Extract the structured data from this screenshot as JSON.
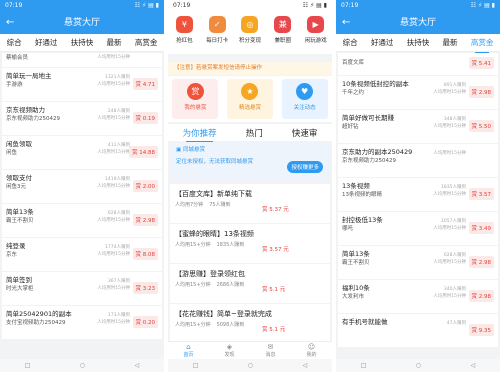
{
  "status": {
    "time": "07:19",
    "right": "☷ ⚡ ▤ ▮"
  },
  "p1": {
    "title": "悬赏大厅",
    "back": "←",
    "tabs": [
      "综合",
      "好通过",
      "扶持快",
      "最新",
      "高赏金"
    ],
    "items": [
      {
        "t": "",
        "sub": "蔡榆会员",
        "s1": "",
        "s2": "人均用时15分钟",
        "r": ""
      },
      {
        "t": "简单玩一局地主",
        "sub": "手游游",
        "s1": "1321人赚到",
        "s2": "人均用时15分钟",
        "r": "赏 4.71"
      },
      {
        "t": "京东视频助力",
        "sub": "京东视频助力250429",
        "s1": "248人赚到",
        "s2": "人均用时15分钟",
        "r": "赏 0.19"
      },
      {
        "t": "闲鱼领取",
        "sub": "闲鱼",
        "s1": "411人赚到",
        "s2": "人均用时15分钟",
        "r": "赏 14.88"
      },
      {
        "t": "领取支付",
        "sub": "闲鱼3元",
        "s1": "1419人赚到",
        "s2": "人均用时15分钟",
        "r": "赏 2.00"
      },
      {
        "t": "简单13条",
        "sub": "霸王不割贝",
        "s1": "628人赚到",
        "s2": "人均用时15分钟",
        "r": "赏 2.98"
      },
      {
        "t": "纯登录",
        "sub": "京东",
        "s1": "1774人赚到",
        "s2": "人均用时15分钟",
        "r": "赏 8.08"
      },
      {
        "t": "简单签到",
        "sub": "时光大掌柜",
        "s1": "367人赚到",
        "s2": "人均用时15分钟",
        "r": "赏 3.23"
      },
      {
        "t": "简单25042901的副本",
        "sub": "支付宝视频助力250429",
        "s1": "173人赚到",
        "s2": "人均用时15分钟",
        "r": "赏 0.20"
      }
    ],
    "nav": [
      "□",
      "○",
      "◁"
    ]
  },
  "p2": {
    "icons": [
      {
        "l": "抢红包",
        "g": "¥",
        "c": "#f0533c"
      },
      {
        "l": "每日打卡",
        "g": "✓",
        "c": "#f08a3c"
      },
      {
        "l": "积分变现",
        "g": "◎",
        "c": "#f5a623"
      },
      {
        "l": "兼职圈",
        "g": "兼",
        "c": "#e8484c"
      },
      {
        "l": "闲玩游戏",
        "g": "▶",
        "c": "#e8484c"
      }
    ],
    "notice": "【注意】若悬赏案发短信请停止操作",
    "cards": [
      {
        "l": "我的悬赏",
        "g": "赏",
        "bg": "#fdeeed",
        "c": "#f0533c"
      },
      {
        "l": "精选悬赏",
        "g": "★",
        "bg": "#fff4e0",
        "c": "#f5a623"
      },
      {
        "l": "关注动态",
        "g": "♥",
        "bg": "#e8f3ff",
        "c": "#2f9bf0"
      }
    ],
    "tabs": [
      "为你推荐",
      "热门",
      "快速审"
    ],
    "city": {
      "h": "▣ 同城悬赏",
      "d": "定位未授权，无法获取同城悬赏",
      "btn": "授权赚更多"
    },
    "items": [
      {
        "t": "【百度文库】新单纯下载",
        "u": "人均用7分钟",
        "n": "75人赚到",
        "r": "赏 5.37 元"
      },
      {
        "t": "【蜜蜂的眼睛】13条视频",
        "u": "人均用15+分钟",
        "n": "1835人赚到",
        "r": "赏 3.57 元"
      },
      {
        "t": "【游思赚】登录领红包",
        "u": "人均用15+分钟",
        "n": "2686人赚到",
        "r": "赏 5.1 元"
      },
      {
        "t": "【花花赚钱】简单~登录就完成",
        "u": "人均用15+分钟",
        "n": "5098人赚到",
        "r": "赏 5.1 元"
      }
    ],
    "bottom": [
      {
        "l": "首页",
        "g": "⌂"
      },
      {
        "l": "发现",
        "g": "◈"
      },
      {
        "l": "消息",
        "g": "✉"
      },
      {
        "l": "我的",
        "g": "☺"
      }
    ],
    "nav": [
      "□",
      "○",
      "◁"
    ]
  },
  "p3": {
    "title": "悬赏大厅",
    "back": "←",
    "tabs": [
      "综合",
      "好通过",
      "扶持快",
      "最新",
      "高赏金"
    ],
    "items": [
      {
        "t": "",
        "sub": "百度文库",
        "s1": "",
        "s2": "",
        "r": "赏 5.41"
      },
      {
        "t": "10条视频低封控的副本",
        "sub": "千年之约",
        "s1": "891人赚到",
        "s2": "人均用时15分钟",
        "r": "赏 2.98"
      },
      {
        "t": "简单好做可长期赚",
        "sub": "超好钻",
        "s1": "348人赚到",
        "s2": "人均用时15分钟",
        "r": "赏 5.50"
      },
      {
        "t": "京东助力的副本250429",
        "sub": "京东视频助力250429",
        "s1": "",
        "s2": "人均用时15分钟",
        "r": ""
      },
      {
        "t": "13条视频",
        "sub": "13条视频的眼睛",
        "s1": "1835人赚到",
        "s2": "人均用时15分钟",
        "r": "赏 3.57"
      },
      {
        "t": "封控极低13条",
        "sub": "哪吒",
        "s1": "1057人赚到",
        "s2": "人均用时15分钟",
        "r": "赏 3.49"
      },
      {
        "t": "简单13条",
        "sub": "霸王不割贝",
        "s1": "628人赚到",
        "s2": "人均用时15分钟",
        "r": "赏 2.98"
      },
      {
        "t": "福利10条",
        "sub": "大发利市",
        "s1": "340人赚到",
        "s2": "人均用时15分钟",
        "r": "赏 2.98"
      },
      {
        "t": "有手机号就能做",
        "sub": "",
        "s1": "47人赚到",
        "s2": "",
        "r": "赏 9.35"
      }
    ],
    "nav": [
      "□",
      "○",
      "◁"
    ]
  }
}
